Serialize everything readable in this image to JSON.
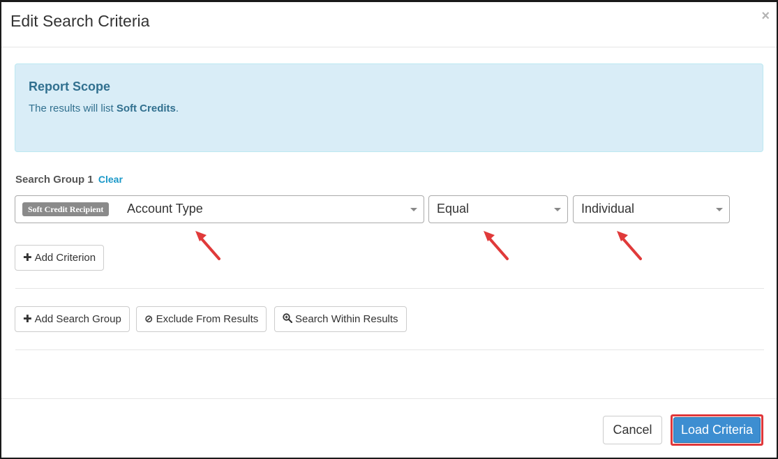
{
  "modal": {
    "title": "Edit Search Criteria",
    "close_glyph": "×"
  },
  "scope": {
    "heading": "Report Scope",
    "text_prefix": "The results will list ",
    "text_bold": "Soft Credits",
    "text_suffix": "."
  },
  "group": {
    "label": "Search Group 1",
    "clear_label": "Clear"
  },
  "criterion": {
    "field_tag": "Soft Credit Recipient",
    "field_value": "Account Type",
    "operator_value": "Equal",
    "value_value": "Individual"
  },
  "buttons": {
    "add_criterion": "Add Criterion",
    "add_search_group": "Add Search Group",
    "exclude_from_results": "Exclude From Results",
    "search_within_results": "Search Within Results",
    "cancel": "Cancel",
    "load_criteria": "Load Criteria"
  },
  "icons": {
    "plus": "plus-icon",
    "ban": "ban-icon",
    "zoom": "zoom-in-icon",
    "close": "close-icon",
    "caret": "caret-down-icon"
  },
  "colors": {
    "primary": "#3d8ed1",
    "highlight": "#e0373a",
    "info_bg": "#d9edf7",
    "info_text": "#31708f",
    "link": "#1a98c8",
    "tag_bg": "#8a8a8a"
  }
}
